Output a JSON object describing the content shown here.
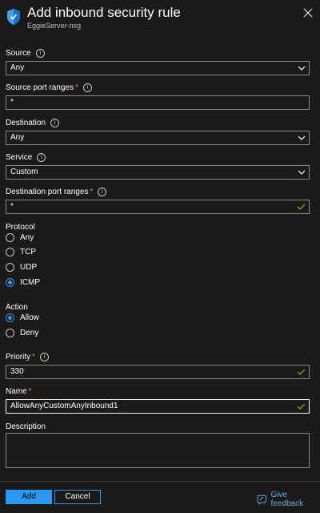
{
  "header": {
    "title": "Add inbound security rule",
    "subtitle": "EggieServer-nsg",
    "icon": "shield-icon",
    "close_icon": "close-icon"
  },
  "source": {
    "label": "Source",
    "value": "Any"
  },
  "source_ports": {
    "label": "Source port ranges",
    "value": "*"
  },
  "destination": {
    "label": "Destination",
    "value": "Any"
  },
  "service": {
    "label": "Service",
    "value": "Custom"
  },
  "dest_ports": {
    "label": "Destination port ranges",
    "value": "*"
  },
  "protocol": {
    "label": "Protocol",
    "options": [
      "Any",
      "TCP",
      "UDP",
      "ICMP"
    ],
    "selected": "ICMP"
  },
  "action": {
    "label": "Action",
    "options": [
      "Allow",
      "Deny"
    ],
    "selected": "Allow"
  },
  "priority": {
    "label": "Priority",
    "value": "330"
  },
  "name": {
    "label": "Name",
    "value": "AllowAnyCustomAnyInbound1"
  },
  "description": {
    "label": "Description",
    "value": ""
  },
  "footer": {
    "add_label": "Add",
    "cancel_label": "Cancel",
    "feedback_label": "Give feedback"
  },
  "colors": {
    "background": "#1b1a19",
    "accent": "#2899f5",
    "required": "#f1707b",
    "check": "#6bb700",
    "link": "#69afe5"
  }
}
